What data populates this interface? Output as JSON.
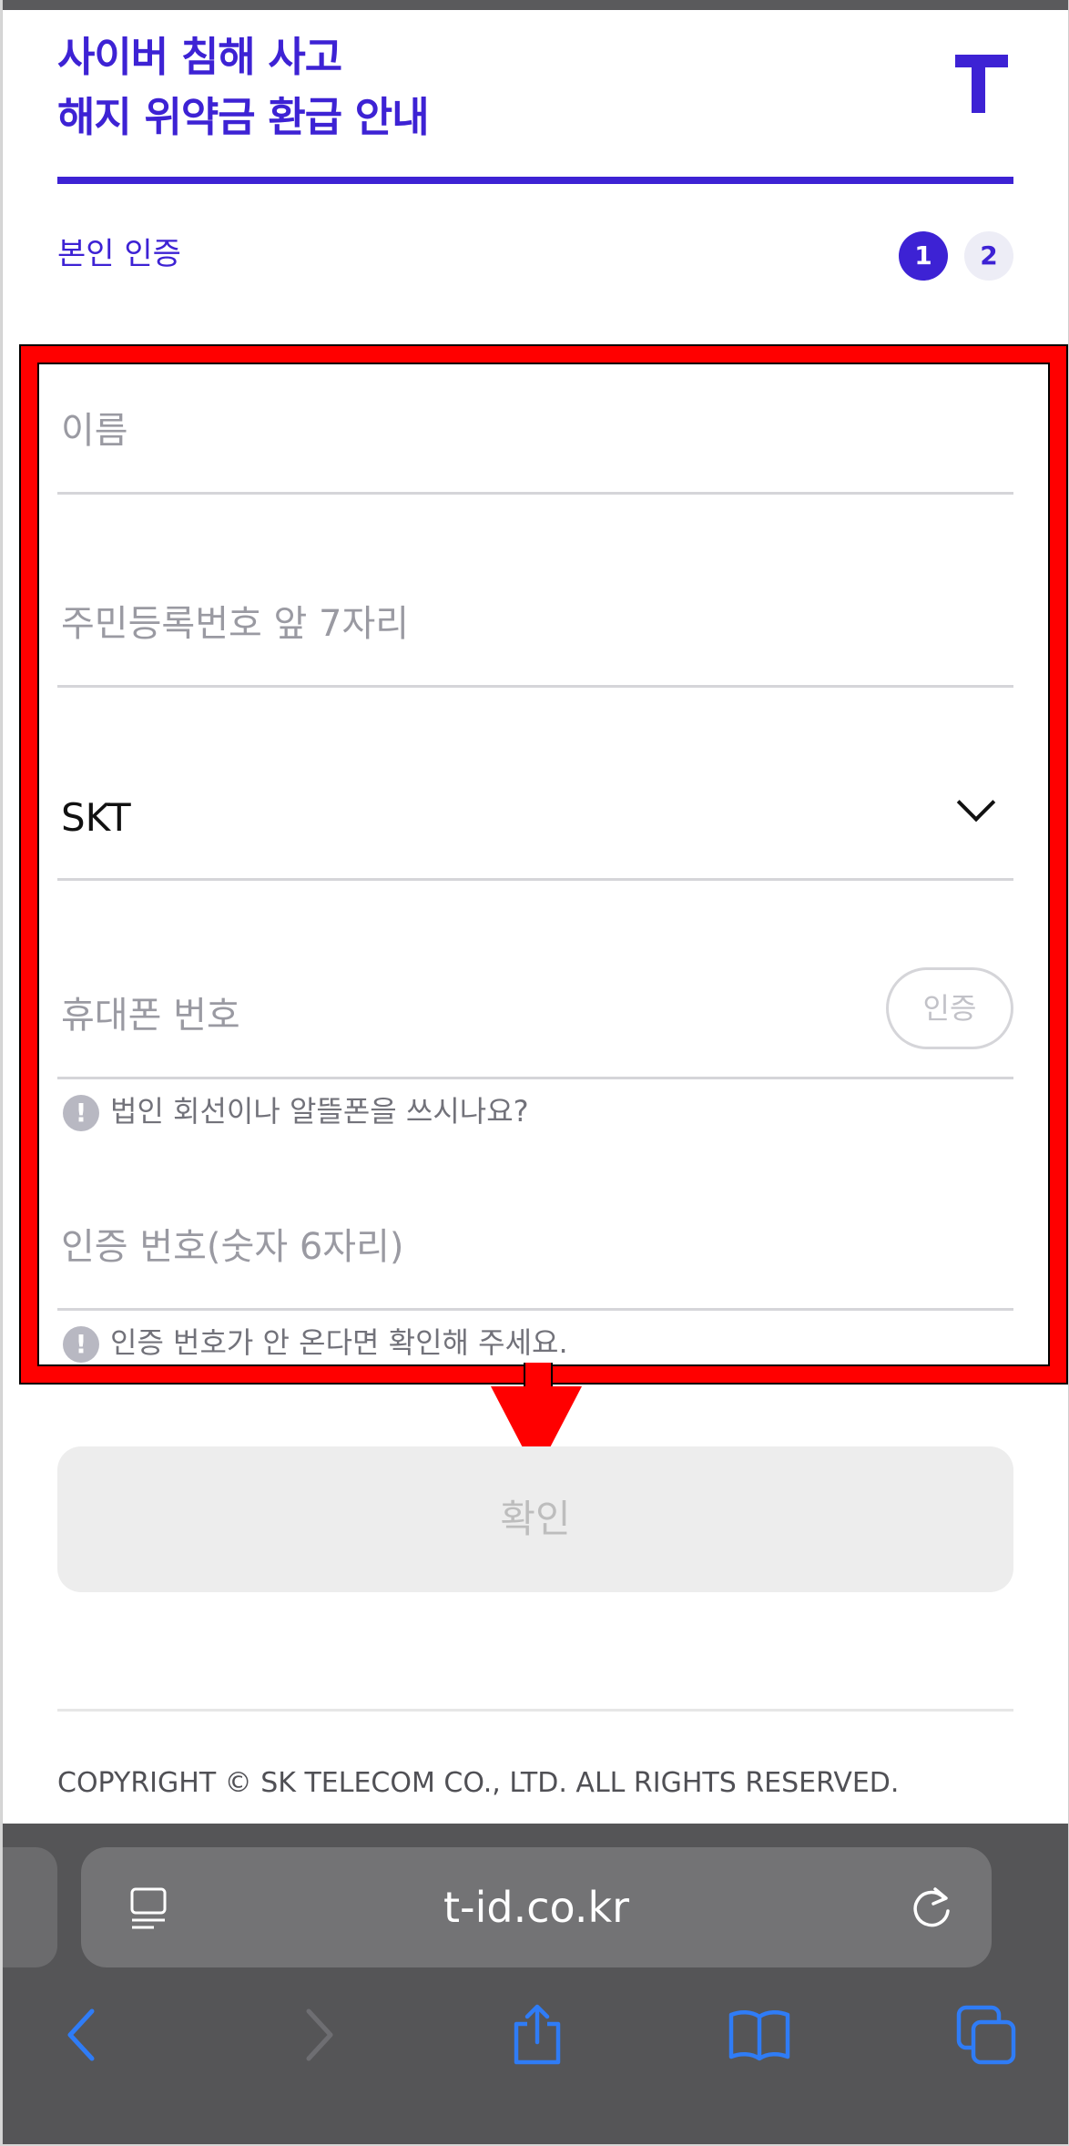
{
  "header": {
    "title_line1": "사이버 침해 사고",
    "title_line2": "해지 위약금 환급 안내",
    "logo": "T"
  },
  "section": {
    "label": "본인 인증",
    "steps": [
      "1",
      "2"
    ],
    "active_step": 1
  },
  "form": {
    "name_placeholder": "이름",
    "rrn_placeholder": "주민등록번호 앞 7자리",
    "carrier_value": "SKT",
    "phone_placeholder": "휴대폰 번호",
    "auth_button": "인증",
    "phone_notice": "법인 회선이나 알뜰폰을 쓰시나요?",
    "code_placeholder": "인증 번호(숫자 6자리)",
    "code_notice": "인증 번호가 안 온다면 확인해 주세요."
  },
  "confirm_button": "확인",
  "footer": {
    "copyright": "COPYRIGHT © SK TELECOM CO., LTD. ALL RIGHTS RESERVED."
  },
  "browser": {
    "url": "t-id.co.kr",
    "icons": [
      "reader-icon",
      "reload-icon",
      "back-icon",
      "forward-icon",
      "share-icon",
      "bookmarks-icon",
      "tabs-icon"
    ]
  },
  "colors": {
    "brand": "#3d22d4",
    "annotation": "#ff0000"
  }
}
